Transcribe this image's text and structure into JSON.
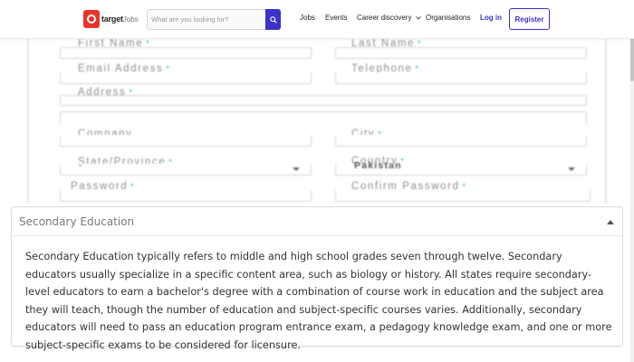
{
  "header": {
    "logo": {
      "brand": "target",
      "suffix": "Jobs"
    },
    "search": {
      "placeholder": "What are you looking for?"
    },
    "nav": {
      "jobs": "Jobs",
      "events": "Events",
      "career": "Career discovery",
      "organisations": "Organisations",
      "login": "Log in",
      "register": "Register"
    }
  },
  "form": {
    "first_name": "First Name",
    "last_name": "Last Name",
    "email": "Email Address",
    "telephone": "Telephone",
    "address": "Address",
    "company": "Company",
    "city": "City",
    "state": "State/Province",
    "state_value": "-",
    "country": "Country",
    "country_value": "Pakistan",
    "password": "Password",
    "confirm_password": "Confirm Password",
    "required_mark": "*"
  },
  "accordion": {
    "title": "Secondary Education",
    "body": "Secondary Education typically refers to middle and high school grades seven through twelve. Secondary educators usually specialize in a specific content area, such as biology or history. All states require secondary-level educators to earn a bachelor's degree with a combination of course work in education and the subject area they will teach, though the number of education and subject-specific courses varies. Additionally, secondary educators will need to pass an education program entrance exam, a pedagogy knowledge exam, and one or more subject-specific exams to be considered for licensure."
  },
  "colors": {
    "brand_red": "#e8352b",
    "accent_purple": "#3b32c9",
    "required_green": "#1fc0a6"
  },
  "icons": {
    "search": "search-icon",
    "chevron": "chevron-down-icon",
    "caret_up": "caret-up-icon"
  }
}
